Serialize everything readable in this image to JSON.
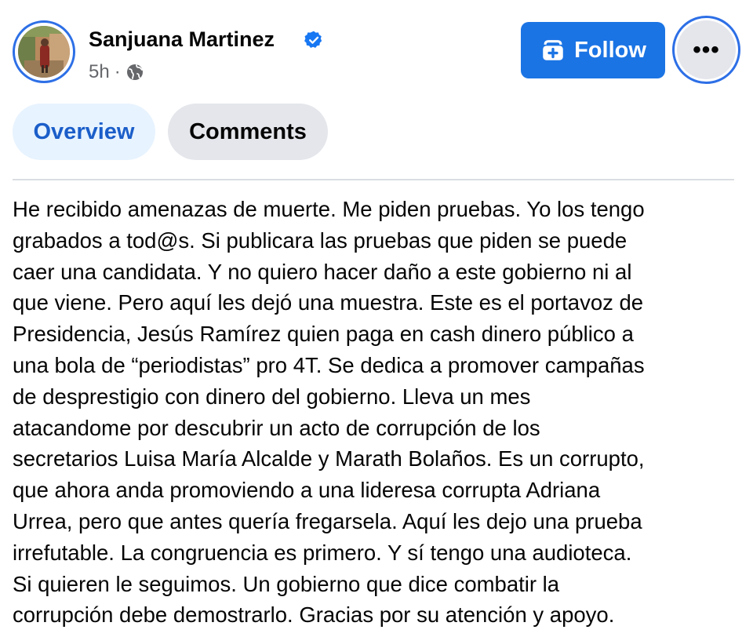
{
  "author": {
    "name": "Sanjuana Martinez",
    "time": "5h",
    "separator": "·"
  },
  "header": {
    "follow_label": "Follow",
    "more_label": "•••"
  },
  "tabs": [
    {
      "label": "Overview",
      "selected": true
    },
    {
      "label": "Comments",
      "selected": false
    }
  ],
  "post": {
    "lines": [
      "He recibido amenazas de muerte. Me piden pruebas. Yo los tengo",
      "grabados a tod@s. Si publicara las pruebas que piden se puede",
      "caer una candidata. Y no quiero hacer daño a este gobierno ni al",
      "que viene. Pero aquí les dejó una muestra. Este es el portavoz de",
      "Presidencia, Jesús Ramírez quien paga en cash dinero público a",
      "una bola de “periodistas” pro 4T. Se dedica a promover campañas",
      "de desprestigio con dinero del gobierno. Lleva un mes",
      "atacandome por descubrir un acto de corrupción de los",
      "secretarios Luisa María Alcalde y Marath Bolaños. Es un corrupto,",
      "que ahora anda promoviendo a una lideresa corrupta Adriana",
      "Urrea, pero que antes quería fregarsela. Aquí les dejo una prueba",
      "irrefutable. La congruencia es primero. Y sí tengo una audioteca.",
      "Si quieren le seguimos. Un gobierno que dice combatir la",
      "corrupción debe demostrarlo. Gracias por su atención y apoyo."
    ]
  },
  "icons": {
    "verified": "verified-badge-icon",
    "audience": "globe-icon",
    "follow": "add-friend-icon",
    "more": "more-options-icon"
  },
  "colors": {
    "accent": "#1b74e4",
    "ring": "#2d6fe6",
    "tab_selected_bg": "#e7f3ff",
    "tab_selected_text": "#1b5ec9",
    "tab_bg": "#e4e6eb",
    "secondary_text": "#65676b"
  }
}
